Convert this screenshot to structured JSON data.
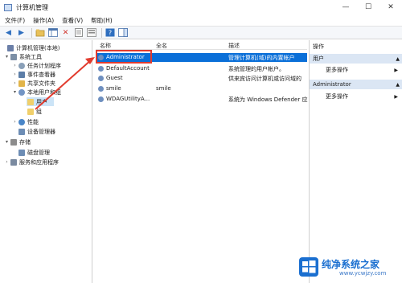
{
  "window": {
    "title": "计算机管理",
    "controls": [
      "—",
      "☐",
      "✕"
    ]
  },
  "menu": [
    "文件(F)",
    "操作(A)",
    "查看(V)",
    "帮助(H)"
  ],
  "tree": [
    {
      "label": "计算机管理(本地)",
      "arrow": "",
      "color": "#6b7fa8"
    },
    {
      "label": "系统工具",
      "arrow": "▾",
      "color": "#7c8fa6"
    },
    {
      "label": "任务计划程序",
      "arrow": "›",
      "color": "#8aa0b8"
    },
    {
      "label": "事件查看器",
      "arrow": "›",
      "color": "#5c7ea8"
    },
    {
      "label": "共享文件夹",
      "arrow": "›",
      "color": "#e2b54a"
    },
    {
      "label": "本地用户和组",
      "arrow": "▾",
      "color": "#7395c4"
    },
    {
      "label": "用户",
      "arrow": "",
      "color": "#f0cf6a"
    },
    {
      "label": "组",
      "arrow": "",
      "color": "#f0cf6a"
    },
    {
      "label": "性能",
      "arrow": "›",
      "color": "#4a86c8"
    },
    {
      "label": "设备管理器",
      "arrow": "",
      "color": "#6d8db5"
    },
    {
      "label": "存储",
      "arrow": "▾",
      "color": "#8c8c8c"
    },
    {
      "label": "磁盘管理",
      "arrow": "",
      "color": "#6d8db5"
    },
    {
      "label": "服务和应用程序",
      "arrow": "›",
      "color": "#7a8aa0"
    }
  ],
  "columns": {
    "name": "名称",
    "fullname": "全名",
    "desc": "描述"
  },
  "users": [
    {
      "name": "Administrator",
      "fullname": "",
      "desc": "管理计算机(域)的内置帐户"
    },
    {
      "name": "DefaultAccount",
      "fullname": "",
      "desc": "系统管理的用户帐户。"
    },
    {
      "name": "Guest",
      "fullname": "",
      "desc": "供来宾访问计算机或访问域的"
    },
    {
      "name": "smile",
      "fullname": "smile",
      "desc": ""
    },
    {
      "name": "WDAGUtilityA...",
      "fullname": "",
      "desc": "系统为 Windows Defender 应"
    }
  ],
  "actions": {
    "header": "操作",
    "sections": [
      {
        "title": "用户",
        "item": "更多操作"
      },
      {
        "title": "Administrator",
        "item": "更多操作"
      }
    ]
  },
  "watermark": {
    "title": "纯净系统之家",
    "url": "www.ycwjzy.com"
  },
  "colors": {
    "selection": "#0a6fd8",
    "highlight": "#e23b2e",
    "accent": "#1a6fd0"
  }
}
